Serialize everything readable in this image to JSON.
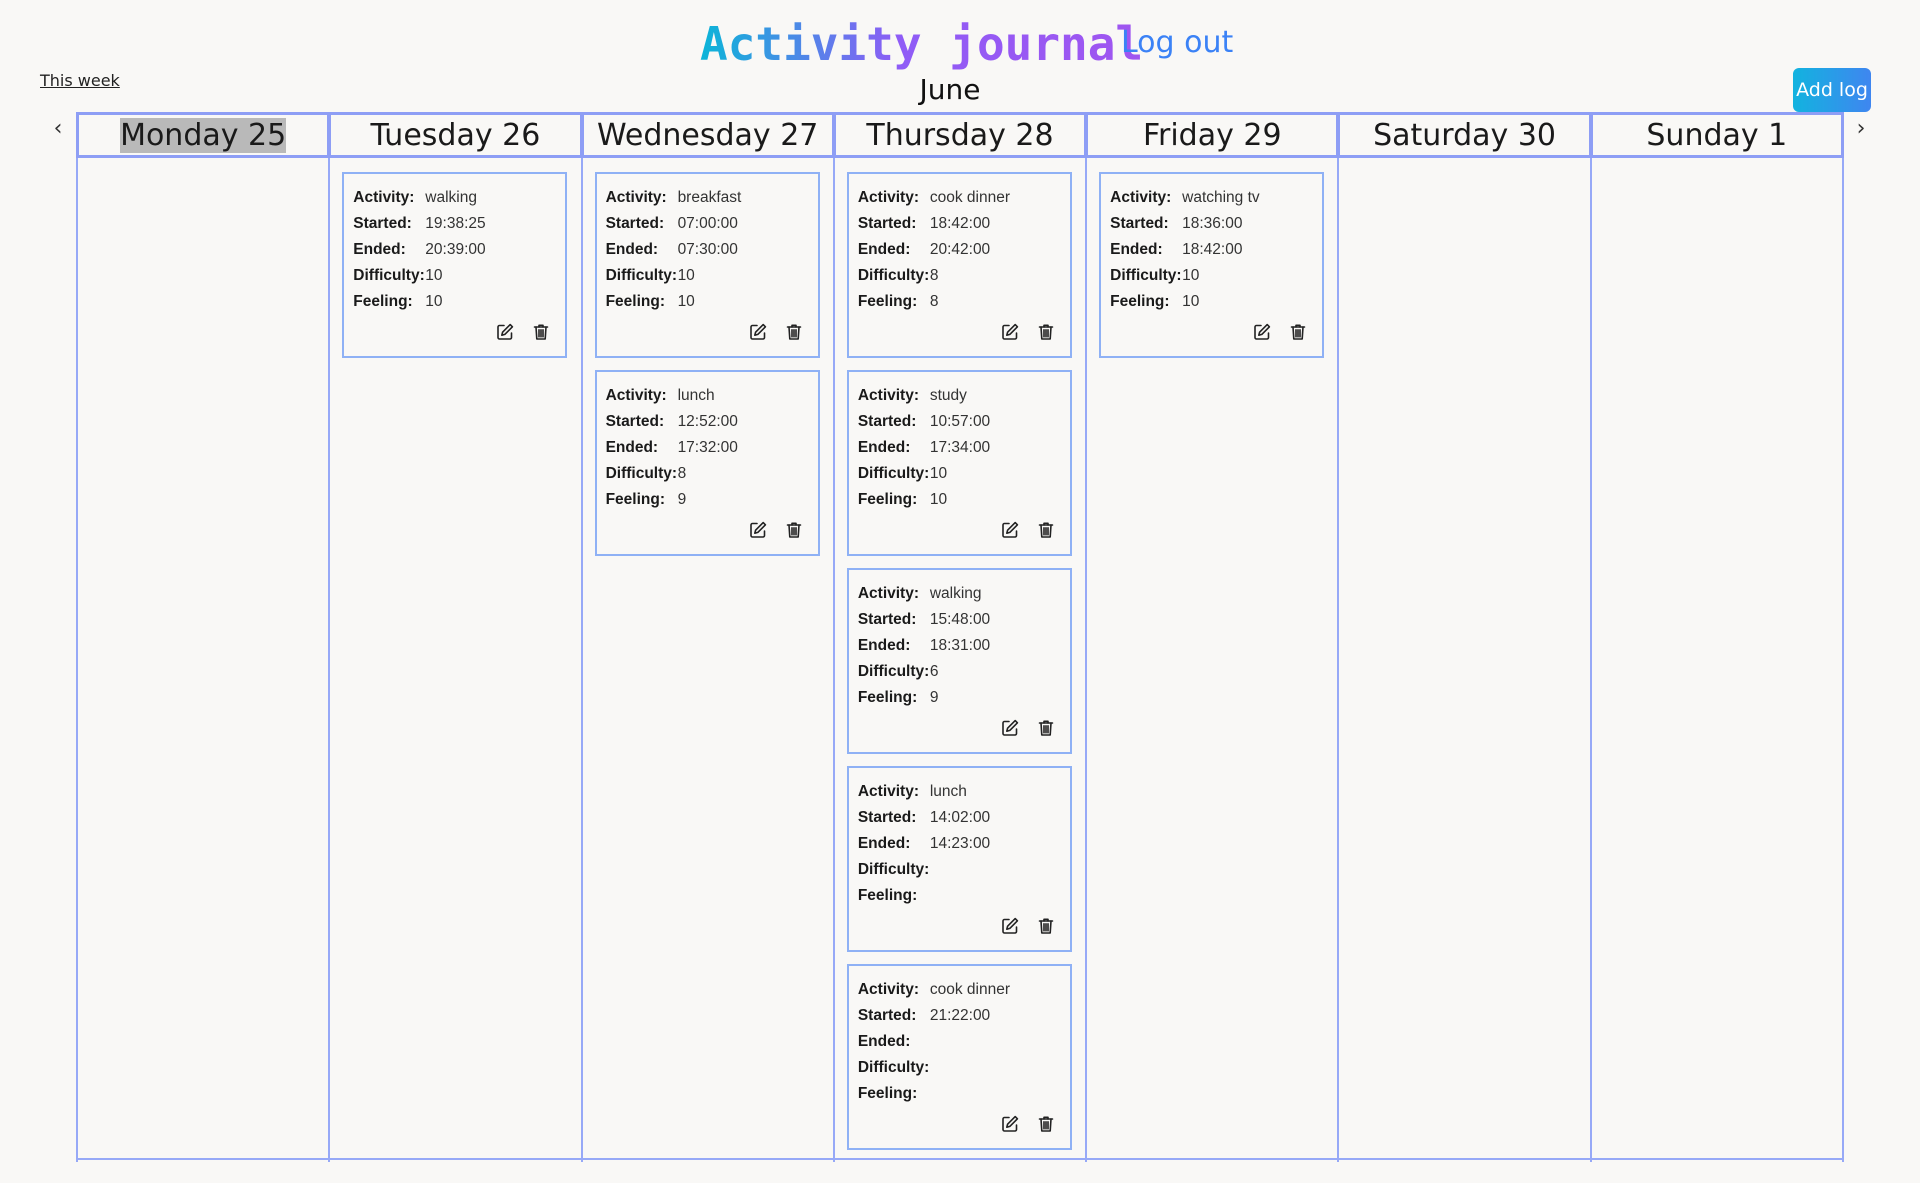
{
  "header": {
    "title": "Activity journal",
    "logout_label": "Log out",
    "this_week_label": "This week",
    "month": "June",
    "add_log_label": "Add log",
    "prev_label": "‹",
    "next_label": "›"
  },
  "labels": {
    "activity": "Activity:",
    "started": "Started:",
    "ended": "Ended:",
    "difficulty": "Difficulty:",
    "feeling": "Feeling:"
  },
  "colors": {
    "accent": "#3b82f6",
    "border": "#8e9ef5",
    "today_highlight": "#b9b9b9"
  },
  "icons": {
    "edit": "edit-icon",
    "delete": "trash-icon"
  },
  "days": [
    {
      "label": "Monday 25",
      "today": true,
      "logs": []
    },
    {
      "label": "Tuesday 26",
      "today": false,
      "logs": [
        {
          "activity": "walking",
          "started": "19:38:25",
          "ended": "20:39:00",
          "difficulty": "10",
          "feeling": "10"
        }
      ]
    },
    {
      "label": "Wednesday 27",
      "today": false,
      "logs": [
        {
          "activity": "breakfast",
          "started": "07:00:00",
          "ended": "07:30:00",
          "difficulty": "10",
          "feeling": "10"
        },
        {
          "activity": "lunch",
          "started": "12:52:00",
          "ended": "17:32:00",
          "difficulty": "8",
          "feeling": "9"
        }
      ]
    },
    {
      "label": "Thursday 28",
      "today": false,
      "logs": [
        {
          "activity": "cook dinner",
          "started": "18:42:00",
          "ended": "20:42:00",
          "difficulty": "8",
          "feeling": "8"
        },
        {
          "activity": "study",
          "started": "10:57:00",
          "ended": "17:34:00",
          "difficulty": "10",
          "feeling": "10"
        },
        {
          "activity": "walking",
          "started": "15:48:00",
          "ended": "18:31:00",
          "difficulty": "6",
          "feeling": "9"
        },
        {
          "activity": "lunch",
          "started": "14:02:00",
          "ended": "14:23:00",
          "difficulty": "",
          "feeling": ""
        },
        {
          "activity": "cook dinner",
          "started": "21:22:00",
          "ended": "",
          "difficulty": "",
          "feeling": ""
        }
      ]
    },
    {
      "label": "Friday 29",
      "today": false,
      "logs": [
        {
          "activity": "watching tv",
          "started": "18:36:00",
          "ended": "18:42:00",
          "difficulty": "10",
          "feeling": "10"
        }
      ]
    },
    {
      "label": "Saturday 30",
      "today": false,
      "logs": []
    },
    {
      "label": "Sunday 1",
      "today": false,
      "logs": []
    }
  ]
}
